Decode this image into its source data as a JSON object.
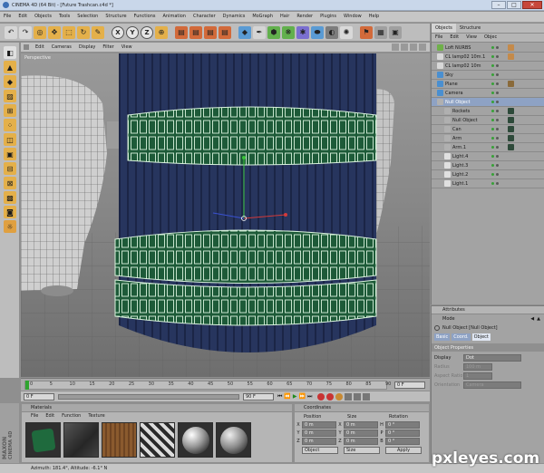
{
  "window": {
    "title": "CINEMA 4D (64 Bit) - [Future Trashcan.c4d *]"
  },
  "menubar": [
    "File",
    "Edit",
    "Objects",
    "Tools",
    "Selection",
    "Structure",
    "Functions",
    "Animation",
    "Character",
    "Dynamics",
    "MoGraph",
    "Hair",
    "Render",
    "Plugins",
    "Window",
    "Help"
  ],
  "toolbar_axes": [
    "X",
    "Y",
    "Z"
  ],
  "viewport": {
    "menus": [
      "Edit",
      "Cameras",
      "Display",
      "Filter",
      "View"
    ],
    "label": "Perspective"
  },
  "object_manager": {
    "tabs": [
      "Objects",
      "Structure"
    ],
    "menus": [
      "File",
      "Edit",
      "View",
      "Objec"
    ],
    "items": [
      {
        "name": "Loft NURBS",
        "indent": 0,
        "icon_color": "#6fb04a"
      },
      {
        "name": "CL lamp02 10m.1",
        "indent": 0,
        "icon_color": "#d8d8d8"
      },
      {
        "name": "CL lamp02 10m",
        "indent": 0,
        "icon_color": "#d8d8d8"
      },
      {
        "name": "Sky",
        "indent": 0,
        "icon_color": "#4a8fd0"
      },
      {
        "name": "Plane",
        "indent": 0,
        "icon_color": "#4a8fd0"
      },
      {
        "name": "Camera",
        "indent": 0,
        "icon_color": "#4a8fd0"
      },
      {
        "name": "Null Object",
        "indent": 0,
        "icon_color": "#b0b0b0",
        "selected": true
      },
      {
        "name": "Rockets",
        "indent": 1,
        "icon_color": "#b0b0b0"
      },
      {
        "name": "Null Object",
        "indent": 1,
        "icon_color": "#b0b0b0"
      },
      {
        "name": "Can",
        "indent": 1,
        "icon_color": "#b0b0b0"
      },
      {
        "name": "Arm",
        "indent": 1,
        "icon_color": "#b0b0b0"
      },
      {
        "name": "Arm.1",
        "indent": 1,
        "icon_color": "#b0b0b0"
      },
      {
        "name": "Light.4",
        "indent": 1,
        "icon_color": "#e0e0e0"
      },
      {
        "name": "Light.3",
        "indent": 1,
        "icon_color": "#e0e0e0"
      },
      {
        "name": "Light.2",
        "indent": 1,
        "icon_color": "#e0e0e0"
      },
      {
        "name": "Light.1",
        "indent": 1,
        "icon_color": "#e0e0e0"
      }
    ]
  },
  "attributes": {
    "title": "Attributes",
    "mode_label": "Mode",
    "object_name": "Null Object [Null Object]",
    "tabs": [
      "Basic",
      "Coord.",
      "Object"
    ],
    "section": "Object Properties",
    "props": [
      {
        "label": "Display",
        "value": "Dot"
      },
      {
        "label": "Radius",
        "value": "100 m"
      },
      {
        "label": "Aspect Ratio",
        "value": "1"
      },
      {
        "label": "Orientation",
        "value": "Camera"
      }
    ]
  },
  "timeline": {
    "ticks": [
      "0",
      "5",
      "10",
      "15",
      "20",
      "25",
      "30",
      "35",
      "40",
      "45",
      "50",
      "55",
      "60",
      "65",
      "70",
      "75",
      "80",
      "85",
      "90"
    ],
    "start_field": "0 F",
    "end_field": "90 F",
    "current_frame": "0 F"
  },
  "materials": {
    "title": "Materials",
    "menus": [
      "File",
      "Edit",
      "Function",
      "Texture"
    ],
    "logo_line1": "MAXON",
    "logo_line2": "CINEMA 4D"
  },
  "coordinates": {
    "title": "Coordinates",
    "headers": [
      "Position",
      "Size",
      "Rotation"
    ],
    "rows": [
      {
        "axis": "X",
        "pos": "0 m",
        "size_axis": "X",
        "size": "0 m",
        "rot_axis": "H",
        "rot": "0 °"
      },
      {
        "axis": "Y",
        "pos": "0 m",
        "size_axis": "Y",
        "size": "0 m",
        "rot_axis": "P",
        "rot": "0 °"
      },
      {
        "axis": "Z",
        "pos": "0 m",
        "size_axis": "Z",
        "size": "0 m",
        "rot_axis": "B",
        "rot": "0 °"
      }
    ],
    "mode_select": "Object",
    "size_select": "Size",
    "apply_label": "Apply"
  },
  "status": {
    "text": "Azimuth: 181.4°, Altitude: -6.1°  N"
  },
  "watermark": "pxleyes.com",
  "colors": {
    "accent_green": "#1f5a3a",
    "can_blue": "#2b3a66",
    "selection_blue": "#8ea2c4"
  }
}
